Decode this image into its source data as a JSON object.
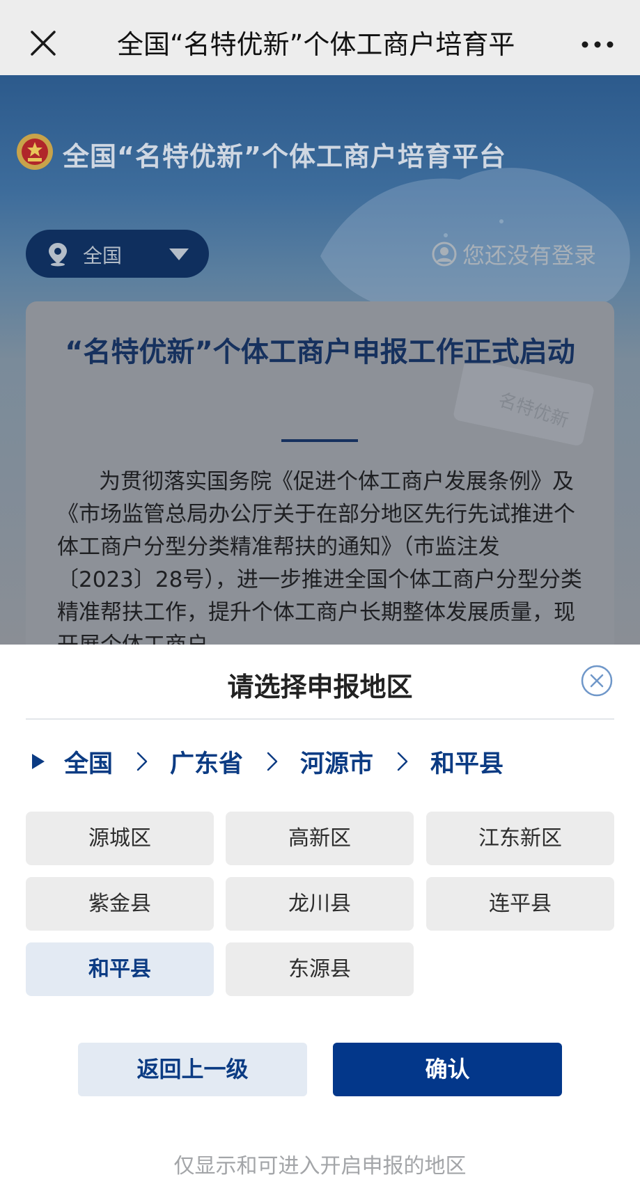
{
  "navbar": {
    "title": "全国“名特优新”个体工商户培育平",
    "close_icon": "close-icon",
    "more_icon": "more-dots-icon"
  },
  "hero": {
    "site_title": "全国“名特优新”个体工商户培育平台",
    "region": "全国",
    "login_text": "您还没有登录"
  },
  "notice": {
    "title": "“名特优新”个体工商户申报工作正式启动",
    "body": "为贯彻落实国务院《促进个体工商户发展条例》及《市场监管总局办公厅关于在部分地区先行先试推进个体工商户分型分类精准帮扶的通知》（市监注发〔2023〕28号），进一步推进全国个体工商户分型分类精准帮扶工作，提升个体工商户长期整体发展质量，现开展个体工商户",
    "watermark_text": "名特优新"
  },
  "sheet": {
    "title": "请选择申报地区",
    "breadcrumb": [
      "全国",
      "广东省",
      "河源市",
      "和平县"
    ],
    "options": [
      {
        "label": "源城区",
        "selected": false
      },
      {
        "label": "高新区",
        "selected": false
      },
      {
        "label": "江东新区",
        "selected": false
      },
      {
        "label": "紫金县",
        "selected": false
      },
      {
        "label": "龙川县",
        "selected": false
      },
      {
        "label": "连平县",
        "selected": false
      },
      {
        "label": "和平县",
        "selected": true
      },
      {
        "label": "东源县",
        "selected": false
      }
    ],
    "back_label": "返回上一级",
    "confirm_label": "确认",
    "footnote": "仅显示和可进入开启申报的地区"
  },
  "colors": {
    "primary": "#03378a",
    "link": "#0b3b83",
    "selected_bg": "#e3eaf3",
    "option_bg": "#ececec"
  }
}
